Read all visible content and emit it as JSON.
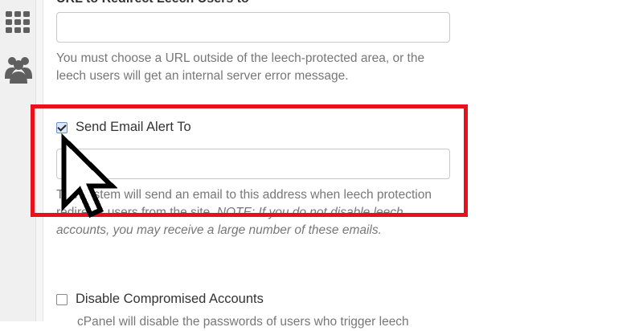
{
  "sidebar": {
    "icons": [
      "grid-icon",
      "users-icon"
    ]
  },
  "section_top": {
    "heading": "URL to Redirect Leech Users to",
    "url_value": "",
    "help": "You must choose a URL outside of the leech-protected area, or the leech users will get an internal server error message."
  },
  "email_alert": {
    "checked": true,
    "label": "Send Email Alert To",
    "value": "",
    "help_plain": "The system will send an email to this address when leech protection redirects users from the site.",
    "help_note": "NOTE: If you do not disable leech accounts, you may receive a large number of these emails."
  },
  "disable_compromised": {
    "checked": false,
    "label": "Disable Compromised Accounts",
    "help": "cPanel will disable the passwords of users who trigger leech"
  },
  "colors": {
    "highlight": "#e8101a",
    "help_text": "#777777",
    "sidebar_icon": "#5f5f5f"
  }
}
